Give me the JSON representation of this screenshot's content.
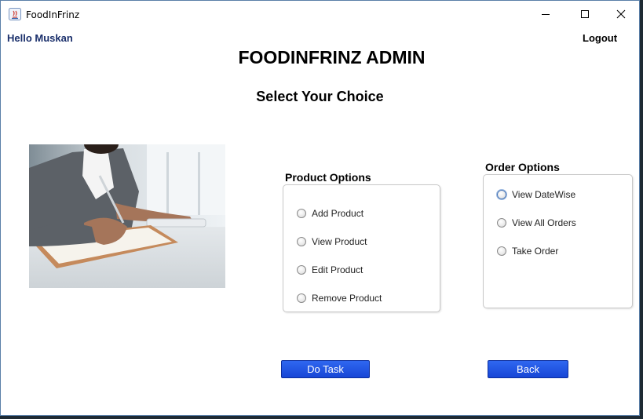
{
  "window": {
    "title": "FoodInFrinz"
  },
  "header": {
    "greeting": "Hello Muskan",
    "logout_label": "Logout"
  },
  "main": {
    "title": "FOODINFRINZ ADMIN",
    "subtitle": "Select Your Choice"
  },
  "product_options": {
    "label": "Product Options",
    "items": [
      "Add Product",
      "View Product",
      "Edit Product",
      "Remove Product"
    ]
  },
  "order_options": {
    "label": "Order Options",
    "items": [
      "View DateWise",
      "View All Orders",
      "Take Order"
    ]
  },
  "buttons": {
    "do_task": "Do Task",
    "back": "Back"
  },
  "colors": {
    "button_blue": "#1f55e6",
    "greeting_color": "#1a2f6b"
  }
}
